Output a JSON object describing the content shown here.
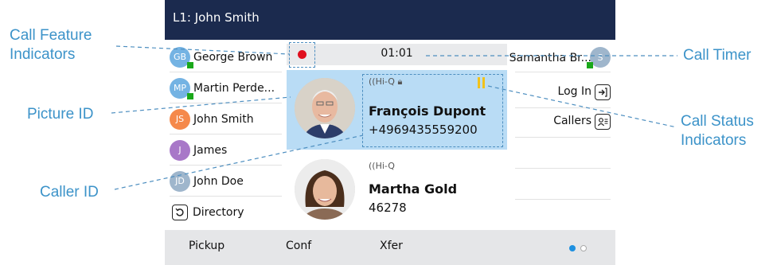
{
  "titlebar": {
    "title": "L1: John Smith"
  },
  "left_keys": [
    {
      "initials": "GB",
      "label": "George Brown",
      "color": "#74b3e3",
      "presence": true
    },
    {
      "initials": "MP",
      "label": "Martin Perde...",
      "color": "#74b3e3",
      "presence": true
    },
    {
      "initials": "JS",
      "label": "John Smith",
      "color": "#f5894b",
      "presence": false
    },
    {
      "initials": "J",
      "label": "James",
      "color": "#a878c8",
      "presence": false
    },
    {
      "initials": "JD",
      "label": "John Doe",
      "color": "#9fb6cc",
      "presence": false
    },
    {
      "icon": "directory-icon",
      "label": "Directory"
    }
  ],
  "call_area": {
    "timer": "01:01",
    "active_call": {
      "badge": "Hi-Q",
      "name": "François Dupont",
      "number": "+4969435559200"
    },
    "held_call": {
      "badge": "Hi-Q",
      "name": "Martha Gold",
      "number": "46278"
    }
  },
  "right_keys": [
    {
      "label": "Samantha Br...",
      "initials": "S",
      "color": "#9fb6cc",
      "presence": true
    },
    {
      "label": "Log In",
      "icon": "login-icon"
    },
    {
      "label": "Callers",
      "icon": "callers-icon"
    }
  ],
  "softkeys": [
    "Pickup",
    "Conf",
    "Xfer"
  ],
  "callouts": {
    "call_feature_indicators": "Call Feature\nIndicators",
    "picture_id": "Picture ID",
    "caller_id": "Caller ID",
    "call_timer": "Call Timer",
    "call_status_indicators": "Call Status\nIndicators"
  },
  "colors": {
    "titlebar": "#1b2a4e",
    "active_call": "#b9dcf5",
    "presence": "#1aa81a",
    "callout": "#3c93c9",
    "hold": "#f2c21b",
    "record": "#e0101f"
  }
}
